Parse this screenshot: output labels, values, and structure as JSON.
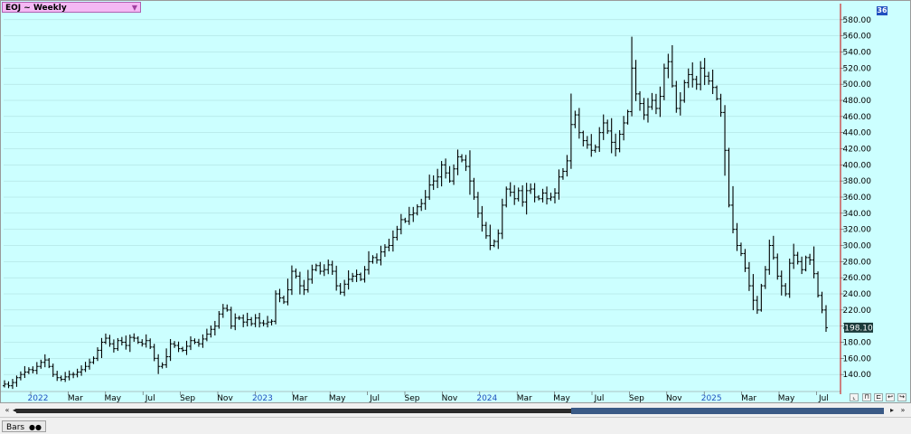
{
  "window": {
    "symbol_title": "EOJ ~ Weekly",
    "corner_badge": "36",
    "current_price_label": "198.10",
    "bottom_tab_label": "Bars",
    "bottom_tab_icon": "eyes-icon"
  },
  "colors": {
    "background": "#ccffff",
    "bars": "#000000",
    "grid": "#a8d8d8",
    "cursor_line": "#cc0000",
    "price_tag_bg": "#1a3a3a",
    "axis_date_text": "#2050c0",
    "symbol_box": "#f4b8f4"
  },
  "chart_data": {
    "type": "bar",
    "style": "OHLC weekly price bars",
    "title": "EOJ ~ Weekly",
    "ylim": [
      120,
      600
    ],
    "yticks": [
      140,
      160,
      180,
      200,
      220,
      240,
      260,
      280,
      300,
      320,
      340,
      360,
      380,
      400,
      420,
      440,
      460,
      480,
      500,
      520,
      540,
      560,
      580
    ],
    "ytick_labels": [
      "140.00",
      "160.00",
      "180.00",
      "200.00",
      "220.00",
      "240.00",
      "260.00",
      "280.00",
      "300.00",
      "320.00",
      "340.00",
      "360.00",
      "380.00",
      "400.00",
      "420.00",
      "440.00",
      "460.00",
      "480.00",
      "500.00",
      "520.00",
      "540.00",
      "560.00",
      "580.00"
    ],
    "xticks": [
      {
        "label": "2022",
        "year": true
      },
      {
        "label": "Mar",
        "year": false
      },
      {
        "label": "May",
        "year": false
      },
      {
        "label": "Jul",
        "year": false
      },
      {
        "label": "Sep",
        "year": false
      },
      {
        "label": "Nov",
        "year": false
      },
      {
        "label": "2023",
        "year": true
      },
      {
        "label": "Mar",
        "year": false
      },
      {
        "label": "May",
        "year": false
      },
      {
        "label": "Jul",
        "year": false
      },
      {
        "label": "Sep",
        "year": false
      },
      {
        "label": "Nov",
        "year": false
      },
      {
        "label": "2024",
        "year": true
      },
      {
        "label": "Mar",
        "year": false
      },
      {
        "label": "May",
        "year": false
      },
      {
        "label": "Jul",
        "year": false
      },
      {
        "label": "Sep",
        "year": false
      },
      {
        "label": "Nov",
        "year": false
      },
      {
        "label": "2025",
        "year": true
      },
      {
        "label": "Mar",
        "year": false
      },
      {
        "label": "May",
        "year": false
      },
      {
        "label": "Jul",
        "year": false
      }
    ],
    "last_price": 198.1,
    "weekly_close": [
      128,
      126,
      130,
      136,
      140,
      143,
      146,
      145,
      150,
      155,
      158,
      150,
      140,
      136,
      134,
      137,
      140,
      140,
      143,
      146,
      150,
      155,
      160,
      170,
      180,
      185,
      178,
      172,
      182,
      180,
      176,
      186,
      185,
      180,
      178,
      182,
      174,
      160,
      150,
      152,
      162,
      178,
      176,
      172,
      170,
      175,
      182,
      180,
      178,
      184,
      190,
      196,
      200,
      215,
      222,
      220,
      200,
      210,
      210,
      205,
      208,
      203,
      210,
      204,
      203,
      205,
      206,
      240,
      235,
      230,
      245,
      268,
      262,
      250,
      245,
      258,
      270,
      275,
      268,
      270,
      276,
      268,
      250,
      242,
      252,
      258,
      262,
      264,
      258,
      270,
      280,
      285,
      282,
      292,
      298,
      300,
      310,
      320,
      332,
      330,
      338,
      340,
      348,
      352,
      360,
      375,
      380,
      385,
      400,
      390,
      380,
      395,
      410,
      406,
      398,
      380,
      360,
      340,
      325,
      312,
      300,
      305,
      315,
      350,
      370,
      366,
      358,
      368,
      354,
      368,
      370,
      360,
      358,
      365,
      358,
      360,
      365,
      385,
      392,
      405,
      450,
      462,
      440,
      430,
      425,
      418,
      422,
      440,
      452,
      442,
      428,
      420,
      438,
      452,
      466,
      520,
      488,
      476,
      462,
      472,
      480,
      470,
      485,
      520,
      528,
      498,
      470,
      480,
      502,
      512,
      506,
      500,
      520,
      510,
      504,
      496,
      482,
      465,
      418,
      350,
      320,
      300,
      290,
      272,
      250,
      232,
      220,
      250,
      270,
      300,
      285,
      262,
      250,
      240,
      278,
      288,
      280,
      270,
      285,
      282,
      265,
      238,
      220,
      198.1
    ]
  }
}
